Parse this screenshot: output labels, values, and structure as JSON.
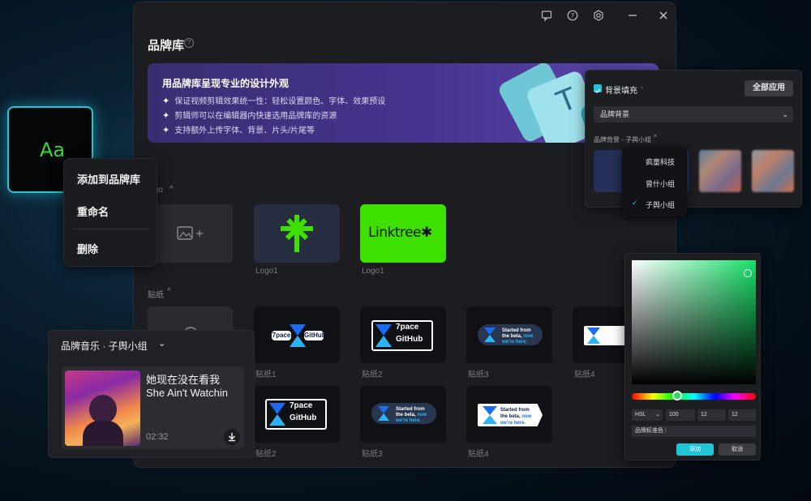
{
  "window": {
    "title": "品牌库",
    "help": "?",
    "toolbar": {
      "feedback": "feedback-icon",
      "help": "help-icon",
      "settings": "gear-icon",
      "minimize": "minimize-icon",
      "close": "close-icon"
    },
    "banner": {
      "headline": "用品牌库呈现专业的设计外观",
      "lines": [
        "保证视频剪辑效果统一性：轻松设置颜色、字体、效果预设",
        "剪辑师可以在编辑器内快速选用品牌库的资源",
        "支持额外上传字体、背景、片头/片尾等"
      ]
    },
    "logo_section": {
      "label": "logo",
      "captions": [
        "Logo1",
        "Logo1"
      ],
      "brands": [
        "Linktree"
      ]
    },
    "sticker_section": {
      "label": "贴纸",
      "captions_row1": [
        "贴纸1",
        "贴纸2",
        "贴纸3",
        "贴纸4"
      ],
      "captions_row2": [
        "贴纸2",
        "贴纸3",
        "贴纸4"
      ],
      "chip_text": [
        "7pace",
        "GitHub"
      ],
      "bubble_text": [
        "Started from",
        "the beta,",
        "now",
        "we're here."
      ]
    }
  },
  "aa_tile": {
    "text": "Aa"
  },
  "context_menu": {
    "items": [
      "添加到品牌库",
      "重命名",
      "删除"
    ]
  },
  "music": {
    "header": "品牌音乐 · 子舆小组",
    "song_cn": "她现在没在看我",
    "song_en": "She Ain't Watchin",
    "duration": "02:32"
  },
  "bg_panel": {
    "checkbox_label": "背景填充",
    "apply_all": "全部应用",
    "select_value": "品牌背景",
    "sub_label": "品牌背景 - 子舆小组",
    "dropdown": [
      "疯童科技",
      "曾什小组",
      "子舆小组"
    ],
    "selected_index": 2
  },
  "picker": {
    "mode": "HSL",
    "values": [
      "100",
      "12",
      "12"
    ],
    "name_field": "品牌标准色",
    "confirm": "添加",
    "cancel": "取消"
  },
  "colors": {
    "accent": "#22c4d8",
    "linktree": "#3ee000",
    "banner": "#473490"
  }
}
